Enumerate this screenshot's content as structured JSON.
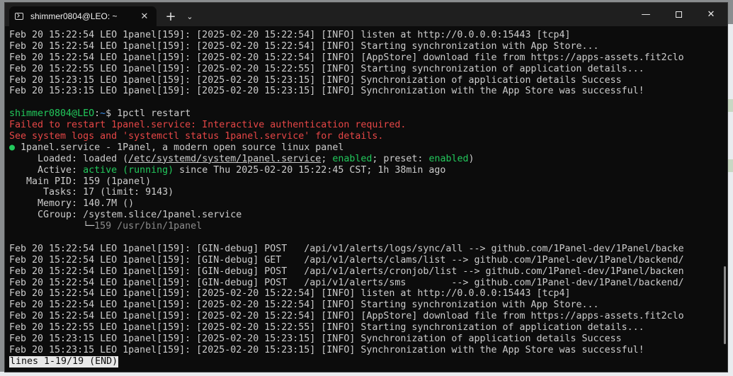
{
  "tab": {
    "title": "shimmer0804@LEO: ~",
    "close": "✕",
    "new_tab": "+",
    "dropdown": "⌄"
  },
  "window_controls": {
    "minimize": "—",
    "close": "✕"
  },
  "truncation_glyph": ">",
  "log_top": [
    {
      "text": "Feb 20 15:22:54 LEO 1panel[159]: [2025-02-20 15:22:54] [INFO] listen at http://0.0.0.0:15443 [tcp4]",
      "trunc": false
    },
    {
      "text": "Feb 20 15:22:54 LEO 1panel[159]: [2025-02-20 15:22:54] [INFO] Starting synchronization with App Store...",
      "trunc": false
    },
    {
      "text": "Feb 20 15:22:54 LEO 1panel[159]: [2025-02-20 15:22:54] [INFO] [AppStore] download file from https://apps-assets.fit2clo",
      "trunc": true
    },
    {
      "text": "Feb 20 15:22:55 LEO 1panel[159]: [2025-02-20 15:22:55] [INFO] Starting synchronization of application details...",
      "trunc": false
    },
    {
      "text": "Feb 20 15:23:15 LEO 1panel[159]: [2025-02-20 15:23:15] [INFO] Synchronization of application details Success",
      "trunc": false
    },
    {
      "text": "Feb 20 15:23:15 LEO 1panel[159]: [2025-02-20 15:23:15] [INFO] Synchronization with the App Store was successful!",
      "trunc": false
    }
  ],
  "prompt": {
    "user_host": "shimmer0804@LEO",
    "sep": ":",
    "path": "~",
    "symbol": "$ ",
    "command": "1pctl restart"
  },
  "error_lines": [
    "Failed to restart 1panel.service: Interactive authentication required.",
    "See system logs and 'systemctl status 1panel.service' for details."
  ],
  "status": {
    "dot": "●",
    "header": " 1panel.service - 1Panel, a modern open source linux panel",
    "loaded_label": "     Loaded: ",
    "loaded_pre": "loaded (",
    "loaded_path": "/etc/systemd/system/1panel.service",
    "loaded_mid": "; ",
    "enabled_1": "enabled",
    "loaded_mid2": "; preset: ",
    "enabled_2": "enabled",
    "loaded_post": ")",
    "active_label": "     Active: ",
    "active_value": "active (running)",
    "active_rest": " since Thu 2025-02-20 15:22:45 CST; 1h 38min ago",
    "mainpid": "   Main PID: 159 (1panel)",
    "tasks": "      Tasks: 17 (limit: 9143)",
    "memory": "     Memory: 140.7M ()",
    "cgroup": "     CGroup: /system.slice/1panel.service",
    "cgroup_tree": "             └─",
    "cgroup_proc": "159 /usr/bin/1panel"
  },
  "log_bottom": [
    {
      "text": "Feb 20 15:22:54 LEO 1panel[159]: [GIN-debug] POST   /api/v1/alerts/logs/sync/all --> github.com/1Panel-dev/1Panel/backe",
      "trunc": true
    },
    {
      "text": "Feb 20 15:22:54 LEO 1panel[159]: [GIN-debug] GET    /api/v1/alerts/clams/list --> github.com/1Panel-dev/1Panel/backend/",
      "trunc": true
    },
    {
      "text": "Feb 20 15:22:54 LEO 1panel[159]: [GIN-debug] POST   /api/v1/alerts/cronjob/list --> github.com/1Panel-dev/1Panel/backen",
      "trunc": true
    },
    {
      "text": "Feb 20 15:22:54 LEO 1panel[159]: [GIN-debug] POST   /api/v1/alerts/sms        --> github.com/1Panel-dev/1Panel/backend/",
      "trunc": true
    },
    {
      "text": "Feb 20 15:22:54 LEO 1panel[159]: [2025-02-20 15:22:54] [INFO] listen at http://0.0.0.0:15443 [tcp4]",
      "trunc": false
    },
    {
      "text": "Feb 20 15:22:54 LEO 1panel[159]: [2025-02-20 15:22:54] [INFO] Starting synchronization with App Store...",
      "trunc": false
    },
    {
      "text": "Feb 20 15:22:54 LEO 1panel[159]: [2025-02-20 15:22:54] [INFO] [AppStore] download file from https://apps-assets.fit2clo",
      "trunc": true
    },
    {
      "text": "Feb 20 15:22:55 LEO 1panel[159]: [2025-02-20 15:22:55] [INFO] Starting synchronization of application details...",
      "trunc": false
    },
    {
      "text": "Feb 20 15:23:15 LEO 1panel[159]: [2025-02-20 15:23:15] [INFO] Synchronization of application details Success",
      "trunc": false
    },
    {
      "text": "Feb 20 15:23:15 LEO 1panel[159]: [2025-02-20 15:23:15] [INFO] Synchronization with the App Store was successful!",
      "trunc": false
    }
  ],
  "pager_status": "lines 1-19/19 (END)",
  "colors": {
    "green": "#22c95c",
    "blue": "#3b8eea",
    "red": "#e64646",
    "fg": "#cccccc",
    "bg": "#0c0c0c"
  }
}
